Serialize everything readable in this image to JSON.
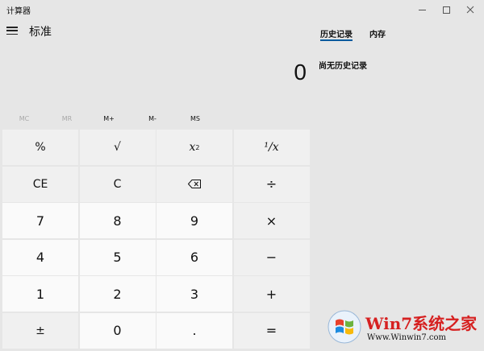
{
  "window": {
    "title": "计算器",
    "controls": [
      "minimize",
      "maximize",
      "close"
    ]
  },
  "mode": {
    "title": "标准"
  },
  "display": {
    "value": "0"
  },
  "memory": {
    "buttons": [
      {
        "label": "MC",
        "enabled": false
      },
      {
        "label": "MR",
        "enabled": false
      },
      {
        "label": "M+",
        "enabled": true
      },
      {
        "label": "M-",
        "enabled": true
      },
      {
        "label": "MS",
        "enabled": true
      }
    ]
  },
  "keypad": {
    "percent": "%",
    "sqrt": "√",
    "square_base": "x",
    "square_exp": "2",
    "reciprocal": "¹/x",
    "ce": "CE",
    "clear": "C",
    "divide": "÷",
    "seven": "7",
    "eight": "8",
    "nine": "9",
    "multiply": "×",
    "four": "4",
    "five": "5",
    "six": "6",
    "subtract": "−",
    "one": "1",
    "two": "2",
    "three": "3",
    "add": "+",
    "negate": "±",
    "zero": "0",
    "decimal": ".",
    "equals": "="
  },
  "panel": {
    "tab_history": "历史记录",
    "tab_memory": "内存",
    "history_empty": "尚无历史记录"
  },
  "watermark": {
    "brand": "Win7系统之家",
    "url": "Www.Winwin7.com"
  },
  "colors": {
    "background": "#e6e6e6",
    "number_key": "#fafafa",
    "function_key": "#f0f0f0",
    "tab_accent": "#005a9e"
  }
}
